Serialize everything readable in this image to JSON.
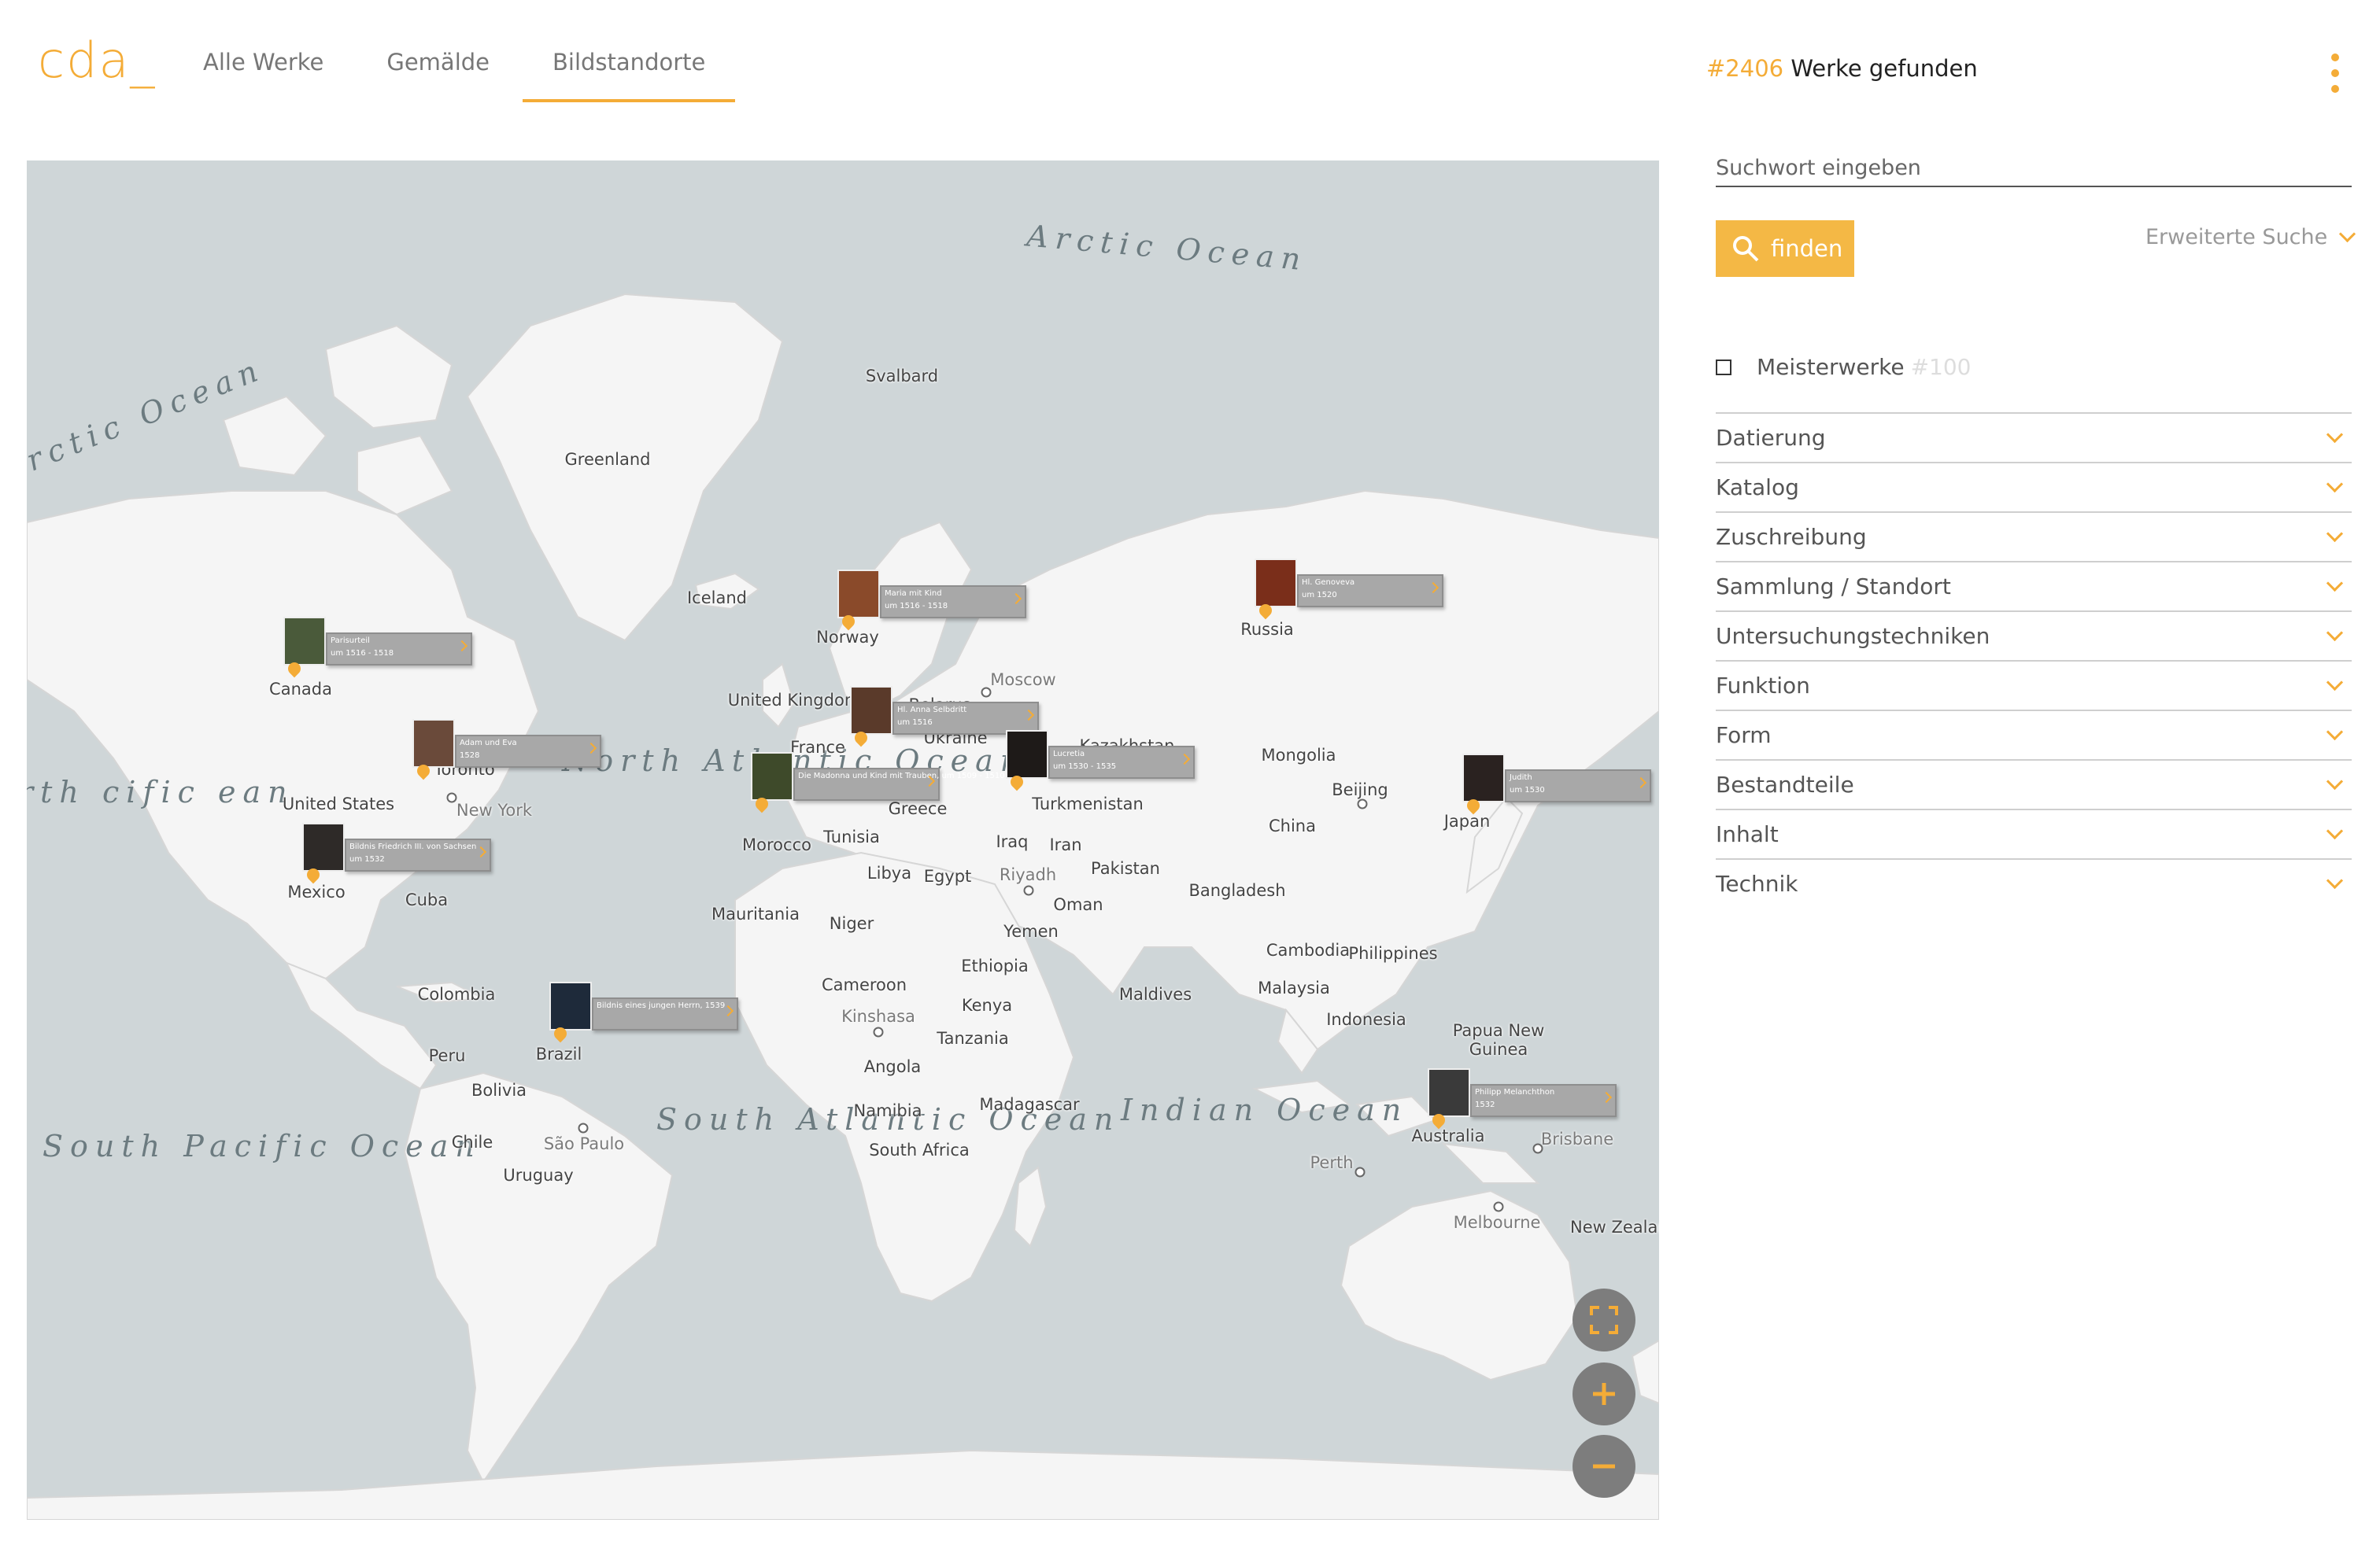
{
  "header": {
    "logo": "cda_",
    "nav": [
      {
        "label": "Alle Werke"
      },
      {
        "label": "Gemälde"
      },
      {
        "label": "Bildstandorte"
      }
    ],
    "count_hash": "#2406",
    "count_text": " Werke gefunden"
  },
  "map": {
    "oceans": [
      "Arctic Ocean",
      "rctic Ocean",
      "North Atlantic Ocean",
      "South Atlantic Ocean",
      "Indian Ocean",
      "South Pacific Ocean",
      "rth cific ean"
    ],
    "labels": [
      "Svalbard",
      "Greenland",
      "Iceland",
      "Norway",
      "Russia",
      "Canada",
      "United Kingdom",
      "Belarus",
      "Moscow",
      "Ukraine",
      "France",
      "Kazakhstan",
      "Mongolia",
      "Toronto",
      "New York",
      "United States",
      "Greece",
      "Turkmenistan",
      "Beijing",
      "Japan",
      "China",
      "Morocco",
      "Tunisia",
      "Iraq",
      "Iran",
      "Mexico",
      "Cuba",
      "Libya",
      "Egypt",
      "Riyadh",
      "Pakistan",
      "Bangladesh",
      "Oman",
      "Mauritania",
      "Niger",
      "Yemen",
      "Ethiopia",
      "Cambodia",
      "Philippines",
      "Colombia",
      "Cameroon",
      "Kenya",
      "Maldives",
      "Malaysia",
      "Kinshasa",
      "Indonesia",
      "Tanzania",
      "Papua New Guinea",
      "Peru",
      "Brazil",
      "Bolivia",
      "Angola",
      "Madagascar",
      "Namibia",
      "Chile",
      "São Paulo",
      "South Africa",
      "Australia",
      "Brisbane",
      "Uruguay",
      "Perth",
      "Melbourne",
      "New Zealand"
    ],
    "markers": [
      {
        "title": "Maria mit Kind",
        "date": "um 1516 - 1518"
      },
      {
        "title": "Hl. Genoveva",
        "date": "um 1520"
      },
      {
        "title": "Parisurteil",
        "date": "um 1516 - 1518"
      },
      {
        "title": "Hl. Anna Selbdritt",
        "date": "um 1516"
      },
      {
        "title": "Adam und Eva",
        "date": "1528"
      },
      {
        "title": "Lucretia",
        "date": "um 1530 - 1535"
      },
      {
        "title": "Die Madonna und Kind mit Trauben, um 1509 - 1510",
        "date": ""
      },
      {
        "title": "Judith",
        "date": "um 1530"
      },
      {
        "title": "Bildnis Friedrich III. von Sachsen",
        "date": "um 1532"
      },
      {
        "title": "Bildnis eines jungen Herrn, 1539",
        "date": ""
      },
      {
        "title": "Philipp Melanchthon",
        "date": "1532"
      }
    ]
  },
  "sidebar": {
    "search_placeholder": "Suchwort eingeben",
    "find_label": "finden",
    "extended_search": "Erweiterte Suche",
    "masterworks_label": "Meisterwerke",
    "masterworks_count": "#100",
    "filters": [
      {
        "label": "Datierung"
      },
      {
        "label": "Katalog"
      },
      {
        "label": "Zuschreibung"
      },
      {
        "label": "Sammlung / Standort"
      },
      {
        "label": "Untersuchungstechniken"
      },
      {
        "label": "Funktion"
      },
      {
        "label": "Form"
      },
      {
        "label": "Bestandteile"
      },
      {
        "label": "Inhalt"
      },
      {
        "label": "Technik"
      }
    ]
  },
  "colors": {
    "accent": "#f4ac37",
    "ocean": "#cfd6d8",
    "land": "#f5f5f5",
    "map_button": "#7d7d7d"
  },
  "icons": {
    "search": "search-icon",
    "menu": "kebab-menu-icon",
    "fullscreen": "fullscreen-icon",
    "zoom_in": "plus-icon",
    "zoom_out": "minus-icon",
    "expand": "chevron-down-icon"
  }
}
